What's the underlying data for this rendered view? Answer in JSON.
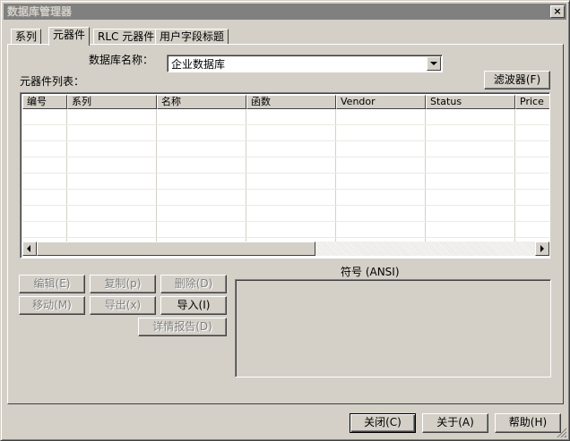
{
  "window": {
    "title": "数据库管理器",
    "close_glyph": "×"
  },
  "tabs": [
    {
      "label": "系列",
      "active": false
    },
    {
      "label": "元器件",
      "active": true
    },
    {
      "label": "RLC 元器件",
      "active": false
    },
    {
      "label": "用户字段标题",
      "active": false
    }
  ],
  "database": {
    "label": "数据库名称：",
    "selected": "企业数据库"
  },
  "filter_button": "滤波器(F)",
  "list": {
    "label": "元器件列表：",
    "columns": [
      "编号",
      "系列",
      "名称",
      "函数",
      "Vendor",
      "Status",
      "Price"
    ],
    "rows": []
  },
  "actions": {
    "edit": "编辑(E)",
    "copy": "复制(p)",
    "delete": "删除(D)",
    "move": "移动(M)",
    "export": "导出(x)",
    "import": "导入(I)",
    "report": "详情报告(D)"
  },
  "symbol": {
    "label": "符号 (ANSI)"
  },
  "footer": {
    "close": "关闭(C)",
    "about": "关于(A)",
    "help": "帮助(H)"
  }
}
